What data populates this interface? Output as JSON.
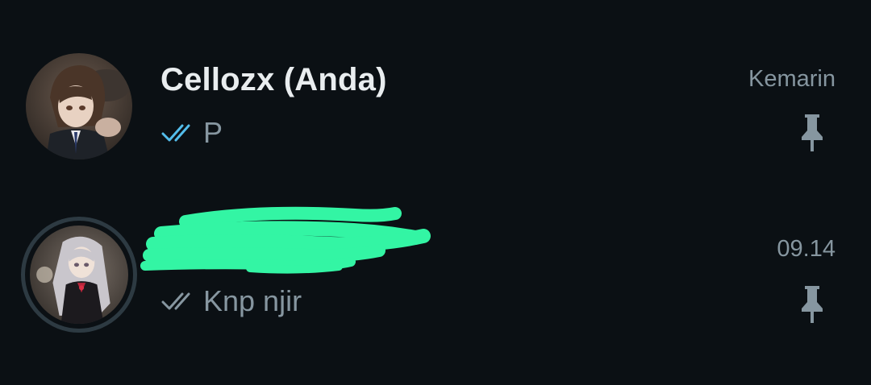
{
  "chats": [
    {
      "name": "Cellozx (Anda)",
      "time": "Kemarin",
      "preview": "P",
      "read_status": "read-blue-double-tick",
      "pinned": true,
      "pin_icon": "pin-icon"
    },
    {
      "name": "",
      "name_redacted": true,
      "time": "09.14",
      "preview": "Knp njir",
      "read_status": "delivered-grey-double-tick",
      "pinned": true,
      "pin_icon": "pin-icon"
    }
  ],
  "colors": {
    "background": "#0b1014",
    "name_text": "#e9edef",
    "secondary_text": "#8696a0",
    "read_tick": "#53bdeb",
    "redaction": "#33f5a4",
    "avatar_ring": "#2d3a42"
  }
}
